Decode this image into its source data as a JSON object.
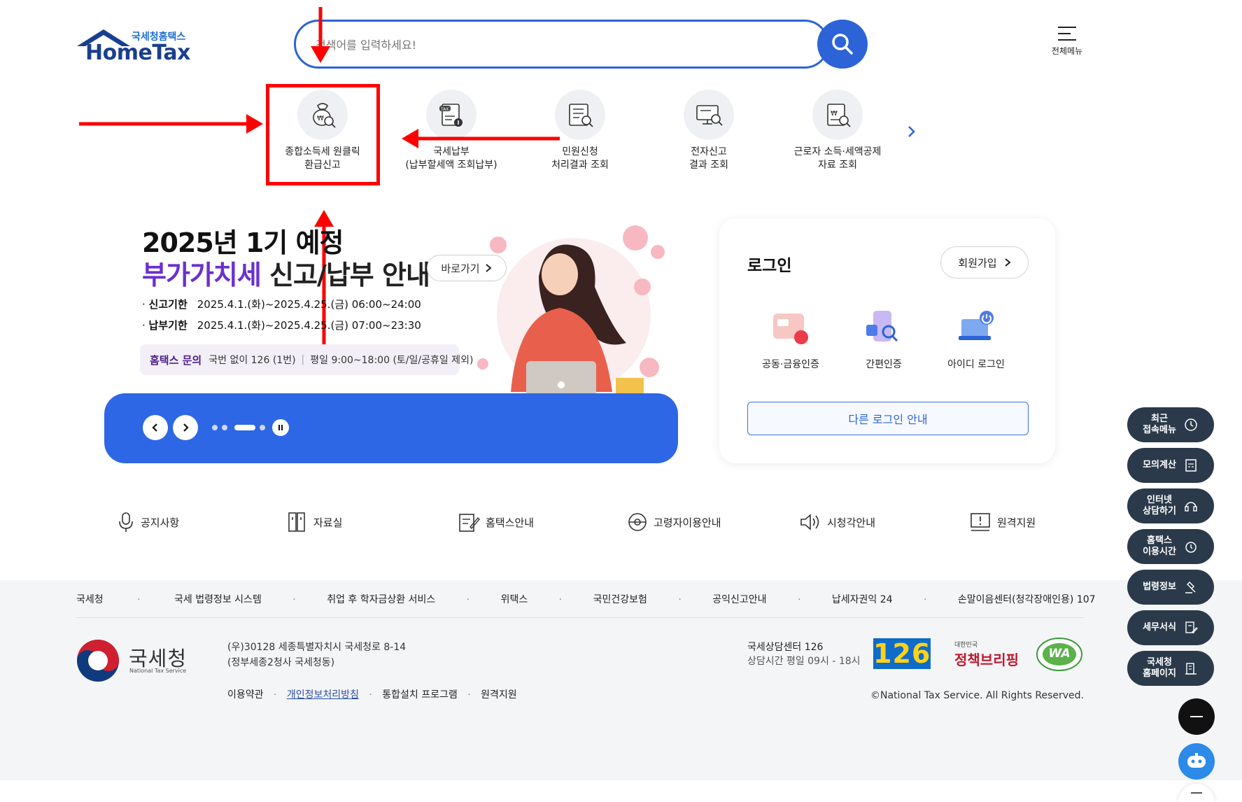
{
  "header": {
    "logo_sub": "국세청홈택스",
    "logo_main": "HomeTax",
    "search_placeholder": "검색어를 입력하세요!",
    "all_menu_label": "전체메뉴"
  },
  "quick_menu": [
    {
      "line1": "종합소득세 원클릭",
      "line2": "환급신고"
    },
    {
      "line1": "국세납부",
      "line2": "(납부할세액 조회납부)"
    },
    {
      "line1": "민원신청",
      "line2": "처리결과 조회"
    },
    {
      "line1": "전자신고",
      "line2": "결과 조회"
    },
    {
      "line1": "근로자 소득·세액공제",
      "line2": "자료 조회"
    }
  ],
  "banner": {
    "title_line1": "2025년 1기 예정",
    "title_highlight": "부가가치세",
    "title_rest": " 신고/납부 안내",
    "go_label": "바로가기",
    "rows": [
      {
        "label": "신고기한",
        "value": "2025.4.1.(화)~2025.4.25.(금) 06:00~24:00"
      },
      {
        "label": "납부기한",
        "value": "2025.4.1.(화)~2025.4.25.(금) 07:00~23:30"
      }
    ],
    "inquiry_label": "홈택스 문의",
    "inquiry_phone": "국번 없이 126 (1번)",
    "inquiry_hours": "평일 9:00~18:00 (토/일/공휴일 제외)"
  },
  "login": {
    "title": "로그인",
    "join_label": "회원가입",
    "methods": [
      "공동·금융인증",
      "간편인증",
      "아이디 로그인"
    ],
    "other_label": "다른 로그인 안내"
  },
  "bottom_nav": [
    "공지사항",
    "자료실",
    "홈택스안내",
    "고령자이용안내",
    "시청각안내",
    "원격지원"
  ],
  "footer": {
    "links": [
      "국세청",
      "국세 법령정보 시스템",
      "취업 후 학자금상환 서비스",
      "위택스",
      "국민건강보험",
      "공익신고안내",
      "납세자권익 24",
      "손말이음센터(청각장애인용) 107"
    ],
    "org_name": "국세청",
    "org_sub": "National Tax Service",
    "address_line1": "(우)30128 세종특별자치시 국세청로 8-14",
    "address_line2": "(정부세종2청사 국세청동)",
    "policy_links": [
      "이용약관",
      "개인정보처리방침",
      "통합설치 프로그램",
      "원격지원"
    ],
    "center_title": "국세상담센터 126",
    "center_hours": "상담시간 평일 09시 - 18시",
    "badge_126": "126",
    "policy_brand_small": "대한민국",
    "policy_brand": "정책브리핑",
    "wa_mark": "WA",
    "copyright": "©National Tax Service. All Rights Reserved."
  },
  "side_menu": [
    {
      "line1": "최근",
      "line2": "접속메뉴"
    },
    {
      "line1": "모의계산",
      "line2": ""
    },
    {
      "line1": "인터넷",
      "line2": "상담하기"
    },
    {
      "line1": "홈택스",
      "line2": "이용시간"
    },
    {
      "line1": "법령정보",
      "line2": ""
    },
    {
      "line1": "세무서식",
      "line2": ""
    },
    {
      "line1": "국세청",
      "line2": "홈페이지"
    }
  ],
  "colors": {
    "brand_blue": "#2c63d6",
    "banner_blue": "#2e67e5",
    "purple": "#6b2fd0",
    "annotation_red": "#ff0000",
    "side_dark": "#2b3a4a"
  }
}
